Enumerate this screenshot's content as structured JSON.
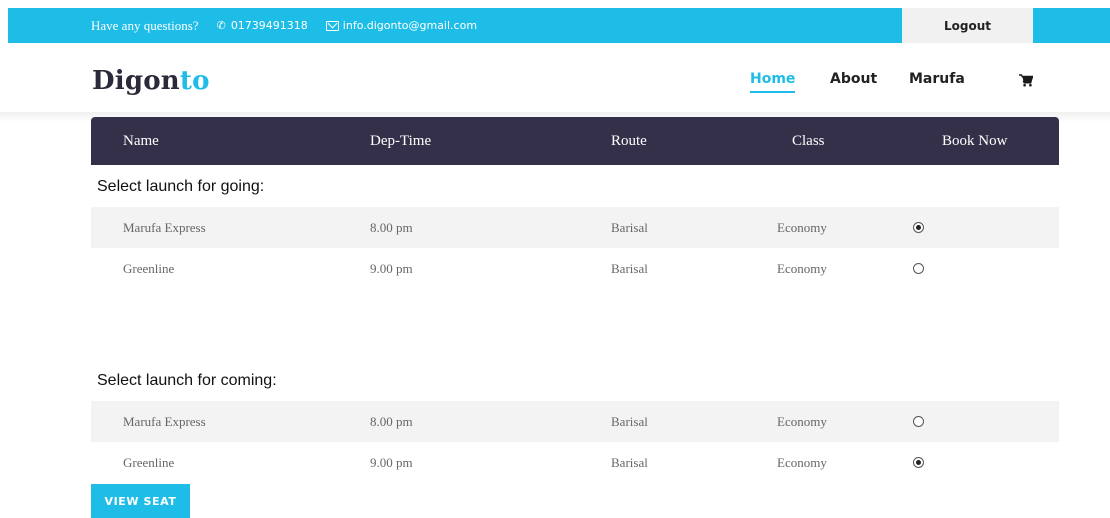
{
  "topbar": {
    "question": "Have any questions?",
    "phone": "01739491318",
    "email": "info.digonto@gmail.com",
    "logout_label": "Logout"
  },
  "brand": {
    "part1": "Digon",
    "part2": "to"
  },
  "nav": {
    "home": "Home",
    "about": "About",
    "user": "Marufa"
  },
  "icons": {
    "phone": "phone-icon",
    "email": "envelope-icon",
    "cart": "cart-icon"
  },
  "colors": {
    "accent": "#1ebde8",
    "table_header": "#35304a",
    "row_shade": "#f3f3f3"
  },
  "table": {
    "headers": [
      "Name",
      "Dep-Time",
      "Route",
      "Class",
      "Book Now"
    ]
  },
  "going": {
    "title": "Select launch for going:",
    "rows": [
      {
        "name": "Marufa Express",
        "time": "8.00 pm",
        "route": "Barisal",
        "class": "Economy",
        "selected": true
      },
      {
        "name": "Greenline",
        "time": "9.00 pm",
        "route": "Barisal",
        "class": "Economy",
        "selected": false
      }
    ]
  },
  "coming": {
    "title": "Select launch for coming:",
    "rows": [
      {
        "name": "Marufa Express",
        "time": "8.00 pm",
        "route": "Barisal",
        "class": "Economy",
        "selected": false
      },
      {
        "name": "Greenline",
        "time": "9.00 pm",
        "route": "Barisal",
        "class": "Economy",
        "selected": true
      }
    ]
  },
  "actions": {
    "view_seat": "VIEW SEAT"
  }
}
